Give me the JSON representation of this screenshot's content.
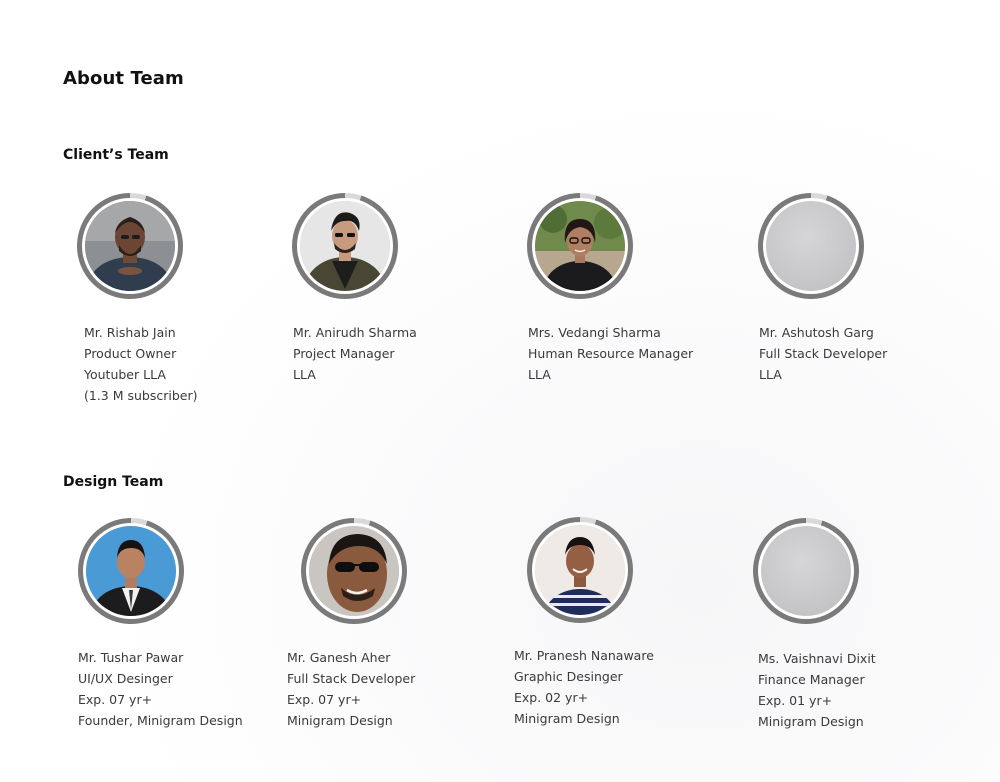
{
  "page": {
    "title": "About Team"
  },
  "sections": [
    {
      "title": "Client’s Team",
      "members": [
        {
          "name": "Mr. Rishab Jain",
          "role": "Product Owner",
          "line3": "Youtuber LLA",
          "line4": "(1.3 M subscriber)",
          "photo": "photo-man-beard-blue-shirt"
        },
        {
          "name": "Mr. Anirudh Sharma",
          "role": "Project Manager",
          "line3": "LLA",
          "line4": "",
          "photo": "photo-man-jacket-glasses"
        },
        {
          "name": "Mrs. Vedangi Sharma",
          "role": "Human Resource Manager",
          "line3": "LLA",
          "line4": "",
          "photo": "photo-woman-glasses-outdoors"
        },
        {
          "name": "Mr. Ashutosh Garg",
          "role": "Full Stack Developer",
          "line3": "LLA",
          "line4": "",
          "photo": "avatar-placeholder"
        }
      ]
    },
    {
      "title": "Design Team",
      "members": [
        {
          "name": "Mr. Tushar Pawar",
          "role": "UI/UX Desinger",
          "line3": "Exp. 07 yr+",
          "line4": "Founder, Minigram Design",
          "photo": "photo-man-suit-blue-bg"
        },
        {
          "name": "Mr. Ganesh Aher",
          "role": "Full Stack Developer",
          "line3": "Exp. 07 yr+",
          "line4": "Minigram Design",
          "photo": "photo-man-sunglasses"
        },
        {
          "name": "Mr. Pranesh Nanaware",
          "role": "Graphic Desinger",
          "line3": "Exp. 02 yr+",
          "line4": "Minigram Design",
          "photo": "photo-boy-striped-shirt"
        },
        {
          "name": "Ms. Vaishnavi Dixit",
          "role": "Finance Manager",
          "line3": "Exp. 01 yr+",
          "line4": "Minigram Design",
          "photo": "avatar-placeholder"
        }
      ]
    }
  ],
  "colors": {
    "ring": "#7a7a7a",
    "placeholder": "#c9c9cb",
    "text": "#3a3a3a"
  }
}
